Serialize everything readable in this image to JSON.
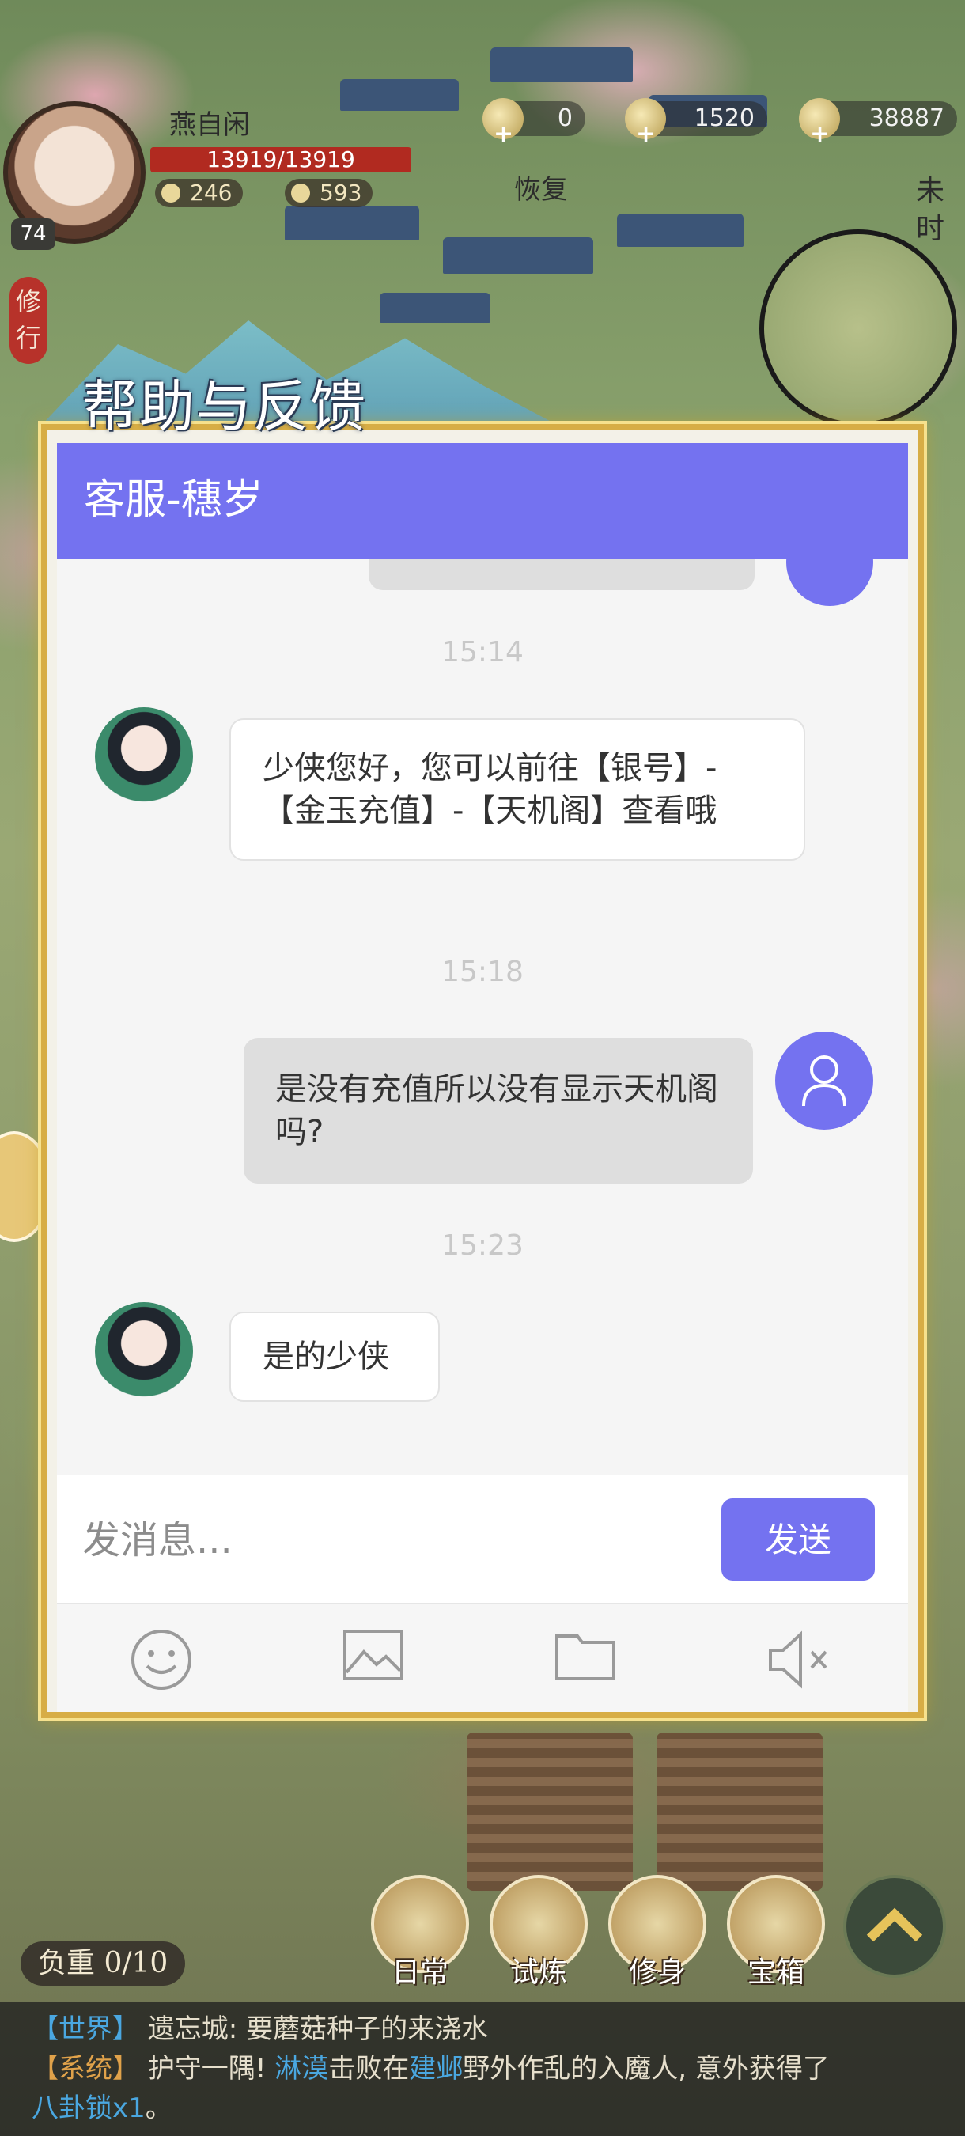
{
  "hud": {
    "player_name": "燕自闲",
    "hp": "13919/13919",
    "level": "74",
    "stat_left": "246",
    "stat_right": "593",
    "resources": [
      "0",
      "1520",
      "38887"
    ],
    "restore_label": "恢复",
    "time_label": "未时",
    "cultivate_label": "修行"
  },
  "dialog": {
    "title": "帮助与反馈",
    "header": "客服-穗岁",
    "messages": [
      {
        "time": "15:14",
        "from": "agent",
        "text": "少侠您好，您可以前往【银号】-【金玉充值】-【天机阁】查看哦"
      },
      {
        "time": "15:18",
        "from": "user",
        "text": "是没有充值所以没有显示天机阁吗?"
      },
      {
        "time": "15:23",
        "from": "agent",
        "text": "是的少侠"
      }
    ],
    "input_placeholder": "发消息...",
    "send_label": "发送",
    "toolbar": [
      "smile-icon",
      "image-icon",
      "folder-icon",
      "mute-icon"
    ],
    "accent_color": "#7472f0"
  },
  "bottom": {
    "load_label": "负重 0/10",
    "buttons": [
      "日常",
      "试炼",
      "修身",
      "宝箱"
    ]
  },
  "chatlog": {
    "line1_tag": "【世界】",
    "line1_text": "遗忘城: 要蘑菇种子的来浇水",
    "line2_tag": "【系统】",
    "line2_prefix": "护守一隅! ",
    "line2_name1": "淋漠",
    "line2_mid": "击败在",
    "line2_name2": "建邺",
    "line2_suffix": "野外作乱的入魔人, 意外获得了",
    "line3_item": "八卦锁x1",
    "line3_end": "。"
  }
}
